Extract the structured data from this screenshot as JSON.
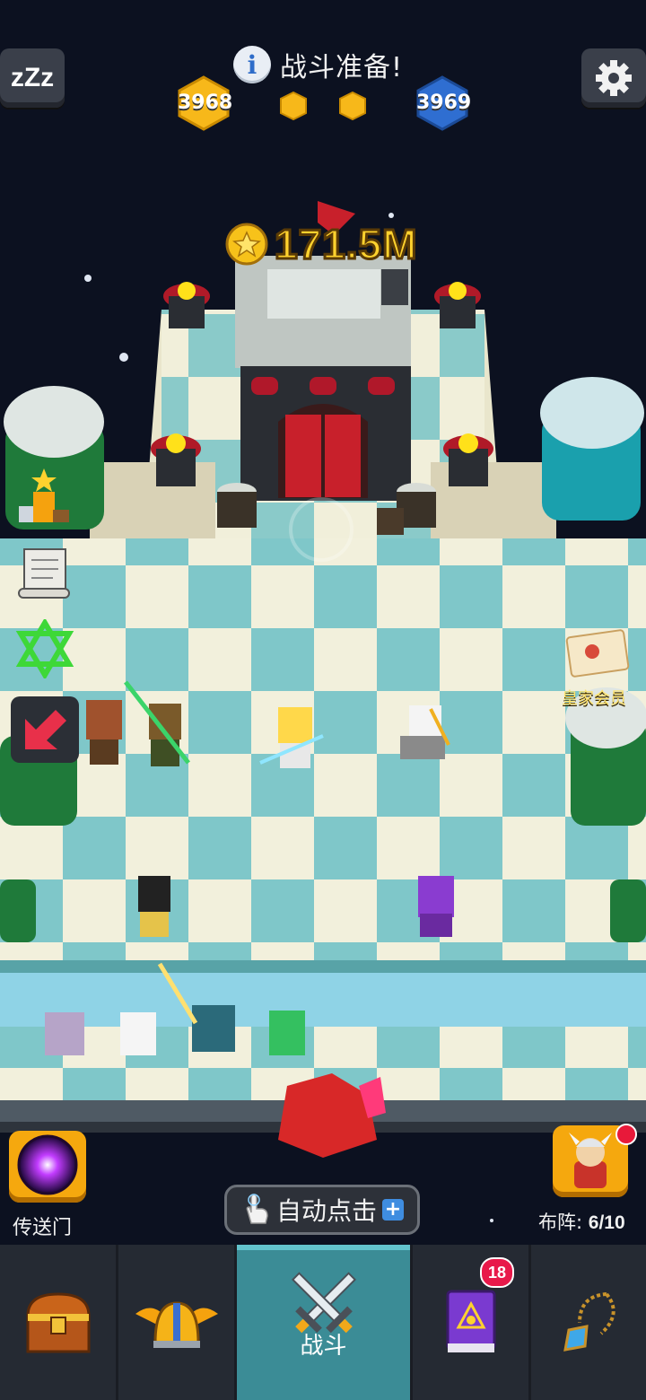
{
  "header": {
    "title": "战斗准备!",
    "player_score": "3968",
    "enemy_score": "3969"
  },
  "reward": {
    "amount": "171.5M"
  },
  "side": {
    "royal_label": "皇家会员"
  },
  "bottom": {
    "portal_label": "传送门",
    "auto_click_label": "自动点击",
    "formation_label": "布阵:",
    "formation_count": "6/10"
  },
  "nav": {
    "battle_label": "战斗",
    "spellbook_badge": "18"
  },
  "colors": {
    "board_light": "#f2f0dc",
    "board_teal": "#7fc7c9",
    "gold": "#ffd22e",
    "player_hex": "#f7b81a",
    "enemy_hex": "#2f6ed1",
    "active_tab": "#3b8c96"
  }
}
